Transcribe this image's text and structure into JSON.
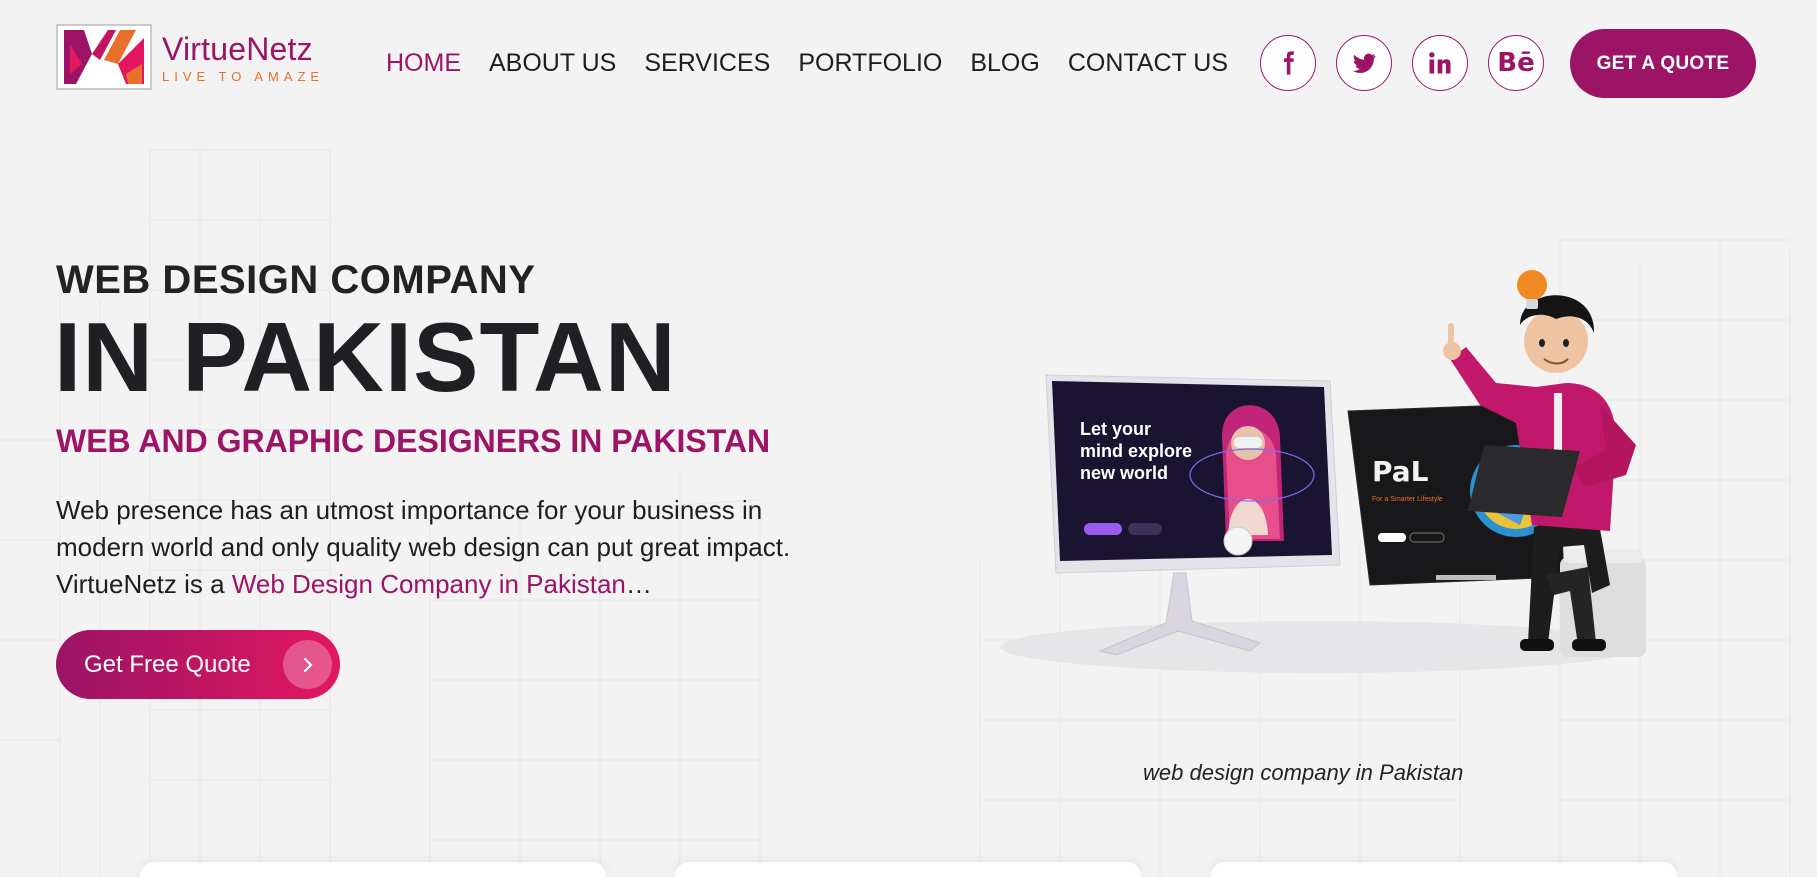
{
  "brand": {
    "name": "VirtueNetz",
    "tagline": "LIVE TO AMAZE"
  },
  "nav": {
    "items": [
      "HOME",
      "ABOUT US",
      "SERVICES",
      "PORTFOLIO",
      "BLOG",
      "CONTACT US"
    ],
    "active": "HOME"
  },
  "socials": [
    "facebook-icon",
    "twitter-icon",
    "linkedin-icon",
    "behance-icon"
  ],
  "header": {
    "quote_label": "GET A QUOTE"
  },
  "hero": {
    "kicker": "WEB DESIGN COMPANY",
    "title": "IN PAKISTAN",
    "subtitle": "WEB AND GRAPHIC DESIGNERS IN PAKISTAN",
    "desc_part1": "Web presence has an utmost importance for your business in modern world and only quality web design can put great impact. VirtueNetz is a ",
    "desc_link": "Web Design Company in Pakistan",
    "desc_end": "…",
    "cta_label": "Get Free Quote",
    "caption": "web design company in Pakistan"
  },
  "mockup": {
    "monitor_headline": [
      "Let your",
      "mind explore",
      "new world"
    ],
    "laptop_brand": "PaL",
    "laptop_tagline": "For a Smarter Lifestyle"
  },
  "colors": {
    "brand": "#9b1466",
    "accent": "#e3175f",
    "orange": "#e8702a",
    "background": "#f3f3f4"
  }
}
